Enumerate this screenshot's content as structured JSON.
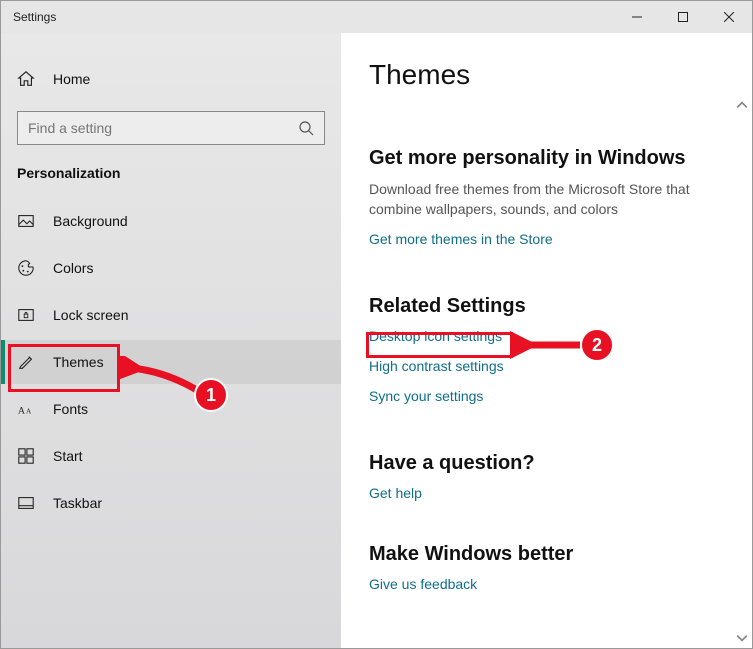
{
  "titlebar": {
    "title": "Settings"
  },
  "sidebar": {
    "home": "Home",
    "search_placeholder": "Find a setting",
    "section": "Personalization",
    "items": [
      {
        "label": "Background"
      },
      {
        "label": "Colors"
      },
      {
        "label": "Lock screen"
      },
      {
        "label": "Themes"
      },
      {
        "label": "Fonts"
      },
      {
        "label": "Start"
      },
      {
        "label": "Taskbar"
      }
    ]
  },
  "main": {
    "title": "Themes",
    "store": {
      "heading": "Get more personality in Windows",
      "desc": "Download free themes from the Microsoft Store that combine wallpapers, sounds, and colors",
      "link": "Get more themes in the Store"
    },
    "related": {
      "heading": "Related Settings",
      "links": [
        "Desktop icon settings",
        "High contrast settings",
        "Sync your settings"
      ]
    },
    "question": {
      "heading": "Have a question?",
      "link": "Get help"
    },
    "better": {
      "heading": "Make Windows better",
      "link": "Give us feedback"
    }
  },
  "annotations": {
    "badge1": "1",
    "badge2": "2"
  }
}
